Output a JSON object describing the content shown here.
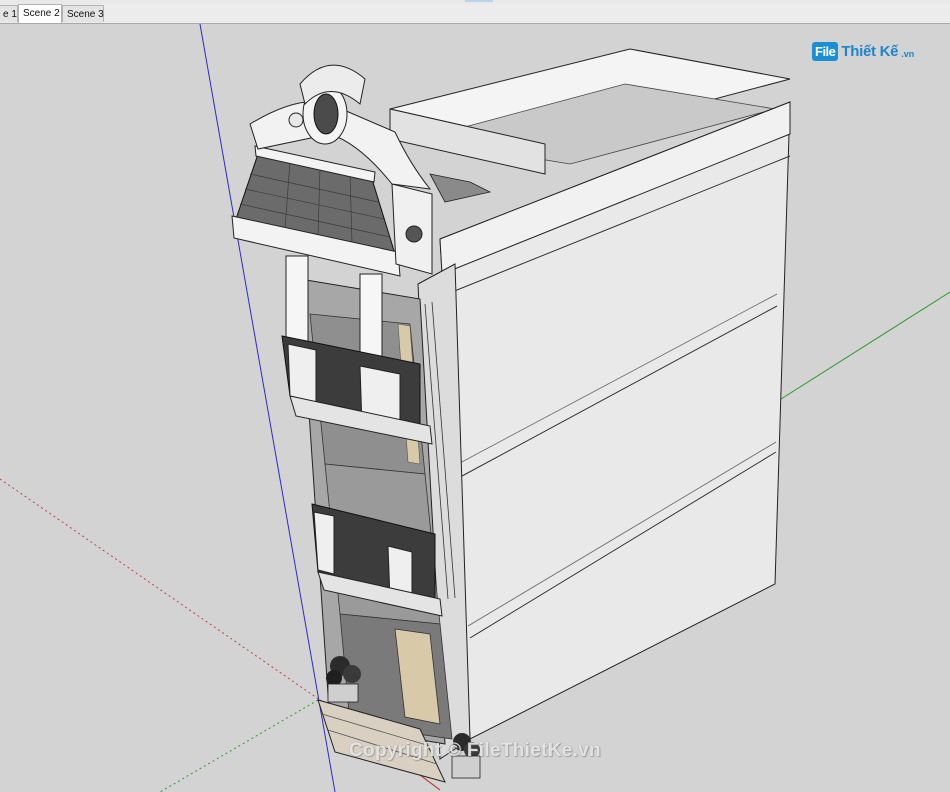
{
  "tabs": [
    {
      "label": "e 1",
      "active": false
    },
    {
      "label": "Scene 2",
      "active": true
    },
    {
      "label": "Scene 3",
      "active": false
    }
  ],
  "logo": {
    "mark": "File",
    "name": "Thiết Kế",
    "tld": ".vn"
  },
  "watermark": "Copyright © FileThietKe.vn",
  "colors": {
    "axis_blue": "#2b2bc4",
    "axis_green": "#2e9c2e",
    "axis_red": "#c44040",
    "roof_tile": "#6b6b6b",
    "wall": "#e7e7e7",
    "glass": "#8f8f8f"
  }
}
